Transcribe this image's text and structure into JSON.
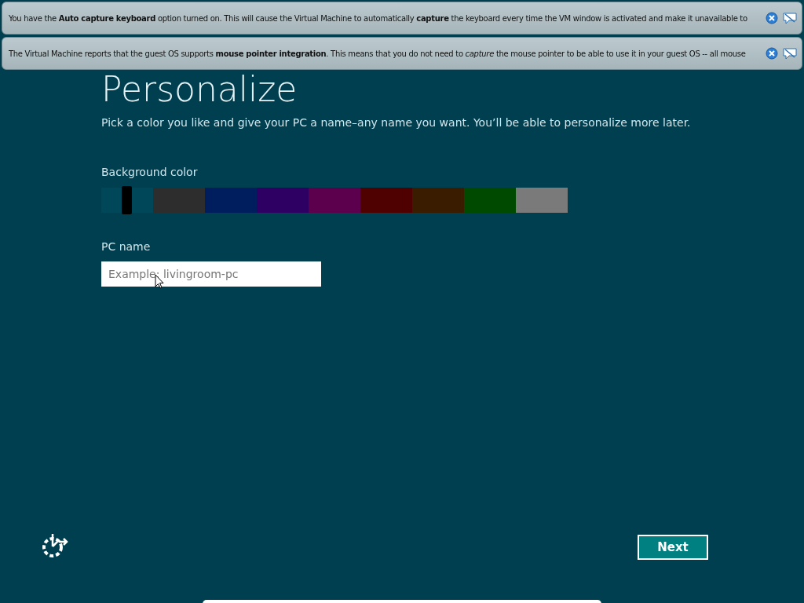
{
  "notifications": [
    {
      "text": "You have the **Auto capture keyboard** option turned on. This will cause the Virtual Machine to automatically **capture** the keyboard every time the VM window is activated and make it unavailable to"
    },
    {
      "text": "The Virtual Machine reports that the guest OS supports **mouse pointer integration**. This means that you do not need to *capture* the mouse pointer to be able to use it in your guest OS -- all mouse"
    }
  ],
  "title": "Personalize",
  "description": "Pick a color you like and give your PC a name–any name you want. You’ll be able to personalize more later.",
  "background_color": {
    "label": "Background color",
    "swatches": [
      {
        "color": "#00475a",
        "selected": true
      },
      {
        "color": "#2d2d2d",
        "selected": false
      },
      {
        "color": "#001e5e",
        "selected": false
      },
      {
        "color": "#2e0063",
        "selected": false
      },
      {
        "color": "#5c004e",
        "selected": false
      },
      {
        "color": "#4f0000",
        "selected": false
      },
      {
        "color": "#3a1d00",
        "selected": false
      },
      {
        "color": "#004a00",
        "selected": false
      },
      {
        "color": "#7a7a7a",
        "selected": false
      }
    ]
  },
  "pc_name": {
    "label": "PC name",
    "placeholder": "Example: livingroom-pc"
  },
  "next_button": "Next"
}
